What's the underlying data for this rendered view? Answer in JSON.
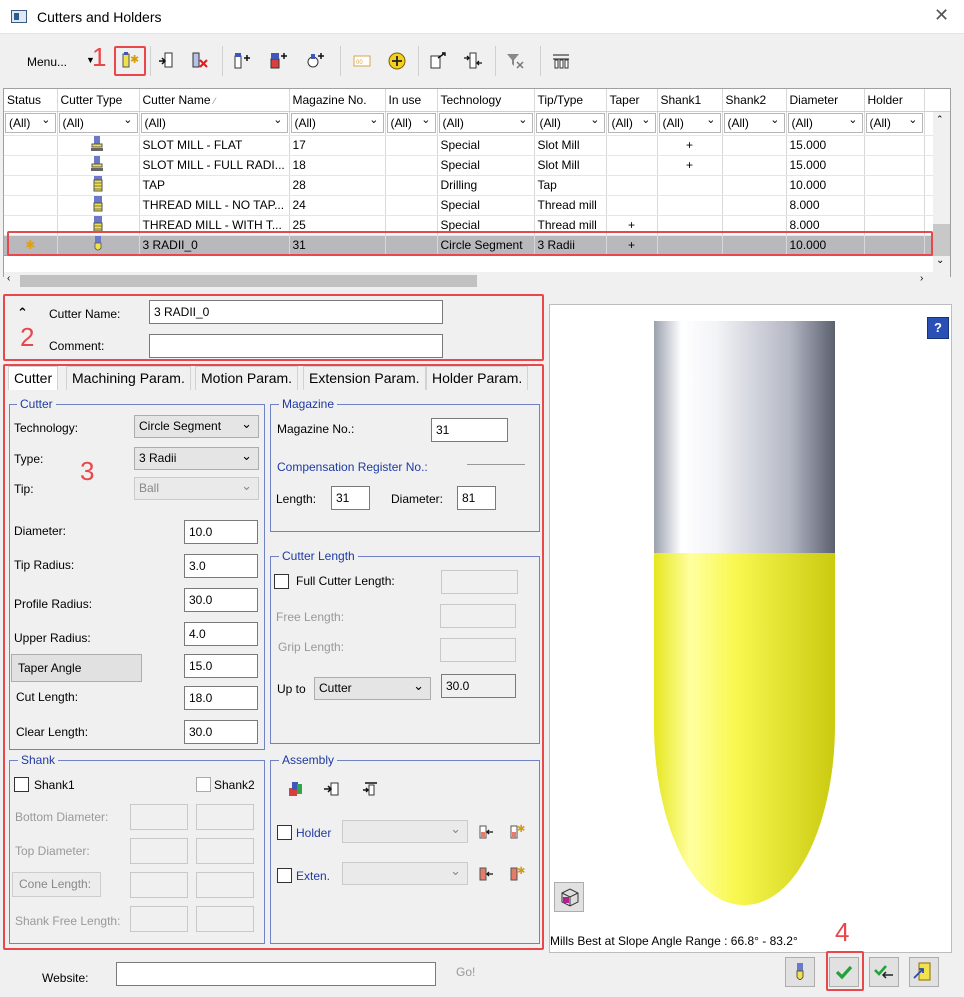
{
  "window": {
    "title": "Cutters and Holders"
  },
  "toolbar": {
    "menu_label": "Menu..."
  },
  "annotations": {
    "n1": "1",
    "n2": "2",
    "n3": "3",
    "n4": "4"
  },
  "grid": {
    "columns": [
      "Status",
      "Cutter Type",
      "Cutter Name",
      "Magazine No.",
      "In use",
      "Technology",
      "Tip/Type",
      "Taper",
      "Shank1",
      "Shank2",
      "Diameter",
      "Holder"
    ],
    "filters": [
      "(All)",
      "(All)",
      "(All)",
      "(All)",
      "(All)",
      "(All)",
      "(All)",
      "(All)",
      "(All)",
      "(All)",
      "(All)",
      "(All)"
    ],
    "rows": [
      {
        "name": "SLOT MILL - FLAT",
        "mag": "17",
        "tech": "Special",
        "tip": "Slot Mill",
        "taper": "",
        "shank1": "+",
        "dia": "15.000"
      },
      {
        "name": "SLOT MILL - FULL RADI...",
        "mag": "18",
        "tech": "Special",
        "tip": "Slot Mill",
        "taper": "",
        "shank1": "+",
        "dia": "15.000"
      },
      {
        "name": "TAP",
        "mag": "28",
        "tech": "Drilling",
        "tip": "Tap",
        "taper": "",
        "shank1": "",
        "dia": "10.000"
      },
      {
        "name": "THREAD MILL - NO TAP...",
        "mag": "24",
        "tech": "Special",
        "tip": "Thread mill",
        "taper": "",
        "shank1": "",
        "dia": "8.000"
      },
      {
        "name": "THREAD MILL - WITH T...",
        "mag": "25",
        "tech": "Special",
        "tip": "Thread mill",
        "taper": "+",
        "shank1": "",
        "dia": "8.000"
      },
      {
        "name": "3 RADII_0",
        "mag": "31",
        "tech": "Circle Segment",
        "tip": "3 Radii",
        "taper": "+",
        "shank1": "",
        "dia": "10.000"
      }
    ]
  },
  "header": {
    "cutter_name_label": "Cutter Name:",
    "cutter_name_value": "3 RADII_0",
    "comment_label": "Comment:",
    "comment_value": ""
  },
  "tabs": [
    "Cutter",
    "Machining Param.",
    "Motion Param.",
    "Extension Param.",
    "Holder Param."
  ],
  "cutter": {
    "title": "Cutter",
    "technology_label": "Technology:",
    "technology_value": "Circle Segment",
    "type_label": "Type:",
    "type_value": "3 Radii",
    "tip_label": "Tip:",
    "tip_value": "Ball",
    "diameter_label": "Diameter:",
    "diameter_value": "10.0",
    "tip_radius_label": "Tip Radius:",
    "tip_radius_value": "3.0",
    "profile_radius_label": "Profile Radius:",
    "profile_radius_value": "30.0",
    "upper_radius_label": "Upper Radius:",
    "upper_radius_value": "4.0",
    "taper_angle_label": "Taper Angle",
    "taper_angle_value": "15.0",
    "cut_length_label": "Cut Length:",
    "cut_length_value": "18.0",
    "clear_length_label": "Clear Length:",
    "clear_length_value": "30.0"
  },
  "magazine": {
    "title": "Magazine",
    "magazine_no_label": "Magazine No.:",
    "magazine_no_value": "31",
    "comp_label": "Compensation Register No.:",
    "length_label": "Length:",
    "length_value": "31",
    "diameter_label": "Diameter:",
    "diameter_value": "81"
  },
  "cutter_length": {
    "title": "Cutter Length",
    "full_label": "Full Cutter Length:",
    "free_label": "Free Length:",
    "grip_label": "Grip Length:",
    "upto_label": "Up to",
    "upto_value": "Cutter",
    "upto_number": "30.0"
  },
  "shank": {
    "title": "Shank",
    "shank1_label": "Shank1",
    "shank2_label": "Shank2",
    "bottom_label": "Bottom Diameter:",
    "top_label": "Top Diameter:",
    "cone_label": "Cone Length:",
    "free_label": "Shank Free Length:"
  },
  "assembly": {
    "title": "Assembly",
    "holder_label": "Holder",
    "exten_label": "Exten."
  },
  "preview": {
    "slope_text": "Mills Best at Slope Angle Range : 66.8° - 83.2°",
    "help": "?"
  },
  "footer": {
    "website_label": "Website:",
    "website_value": "",
    "go_label": "Go!"
  },
  "colors": {
    "accent_red": "#e8474b",
    "group_blue": "#1e3aa3",
    "tool_yellow": "#f2f23a",
    "holder_gray": "#8a8c9a",
    "ok_green": "#22a33a"
  }
}
